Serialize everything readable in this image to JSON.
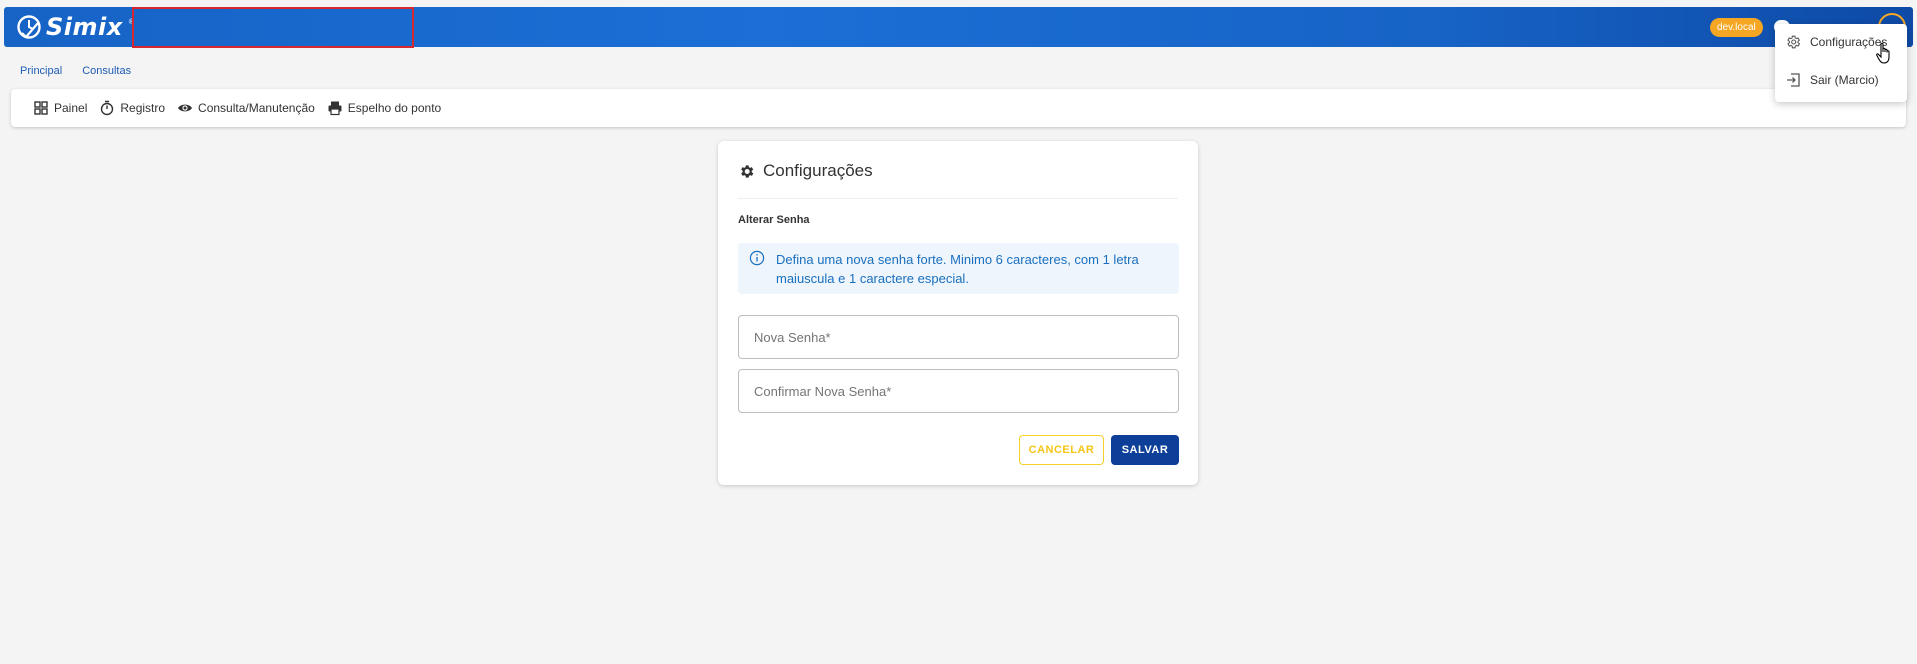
{
  "header": {
    "logo_text": "Simix",
    "logo_mark": "®",
    "env_badge": "dev.local"
  },
  "breadcrumb": [
    "Principal",
    "Consultas"
  ],
  "nav": {
    "items": [
      {
        "label": "Painel",
        "icon": "grid-icon"
      },
      {
        "label": "Registro",
        "icon": "stopwatch-icon"
      },
      {
        "label": "Consulta/Manutenção",
        "icon": "eye-icon"
      },
      {
        "label": "Espelho do ponto",
        "icon": "printer-icon"
      }
    ]
  },
  "card": {
    "title": "Configurações",
    "section_label": "Alterar Senha",
    "info_text": "Defina uma nova senha forte. Minimo 6 caracteres, com 1 letra maiuscula e 1 caractere especial.",
    "new_password_placeholder": "Nova Senha*",
    "confirm_password_placeholder": "Confirmar Nova Senha*",
    "cancel_label": "CANCELAR",
    "save_label": "SALVAR"
  },
  "menu": {
    "items": [
      {
        "label": "Configurações",
        "icon": "gear-icon"
      },
      {
        "label": "Sair (Marcio)",
        "icon": "logout-icon"
      }
    ]
  },
  "colors": {
    "header_blue": "#1b6fd6",
    "save_button": "#0d3e98",
    "cancel_border": "#f5d028",
    "env_badge": "#f5a623",
    "info_text": "#1a6fbf"
  }
}
